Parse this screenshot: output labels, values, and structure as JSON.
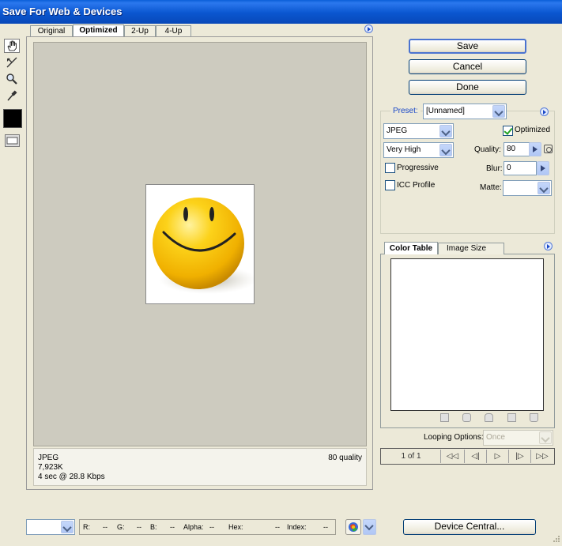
{
  "window": {
    "title": "Save For Web & Devices"
  },
  "tabs": [
    {
      "label": "Original"
    },
    {
      "label": "Optimized",
      "active": true
    },
    {
      "label": "2-Up"
    },
    {
      "label": "4-Up"
    }
  ],
  "tools": [
    "hand-icon",
    "slice-select-icon",
    "zoom-icon",
    "eyedropper-icon"
  ],
  "info": {
    "format": "JPEG",
    "size": "7,923K",
    "time": "4 sec @ 28.8 Kbps",
    "quality": "80 quality"
  },
  "buttons": {
    "save": "Save",
    "cancel": "Cancel",
    "done": "Done",
    "device_central": "Device Central..."
  },
  "settings": {
    "preset_label": "Preset:",
    "preset_value": "[Unnamed]",
    "format_value": "JPEG",
    "quality_preset": "Very High",
    "optimized_label": "Optimized",
    "optimized_checked": true,
    "quality_label": "Quality:",
    "quality_value": "80",
    "progressive_label": "Progressive",
    "progressive_checked": false,
    "blur_label": "Blur:",
    "blur_value": "0",
    "icc_label": "ICC Profile",
    "icc_checked": false,
    "matte_label": "Matte:",
    "matte_value": ""
  },
  "color_panel": {
    "tabs": [
      "Color Table",
      "Image Size"
    ],
    "active": "Color Table"
  },
  "animation": {
    "looping_label": "Looping Options:",
    "looping_value": "Once",
    "frame_counter": "1 of 1",
    "controls": [
      "◁◁",
      "◁|",
      "▷",
      "|▷",
      "▷▷"
    ]
  },
  "status": {
    "zoom_value": "",
    "r_label": "R:",
    "r_value": "--",
    "g_label": "G:",
    "g_value": "--",
    "b_label": "B:",
    "b_value": "--",
    "alpha_label": "Alpha:",
    "alpha_value": "--",
    "hex_label": "Hex:",
    "hex_value": "--",
    "index_label": "Index:",
    "index_value": "--"
  },
  "colors": {
    "title_bar": "#0a56d0",
    "canvas_bg": "#cdcbbf",
    "smiley": "#f5c400",
    "accent": "#3169c6"
  }
}
